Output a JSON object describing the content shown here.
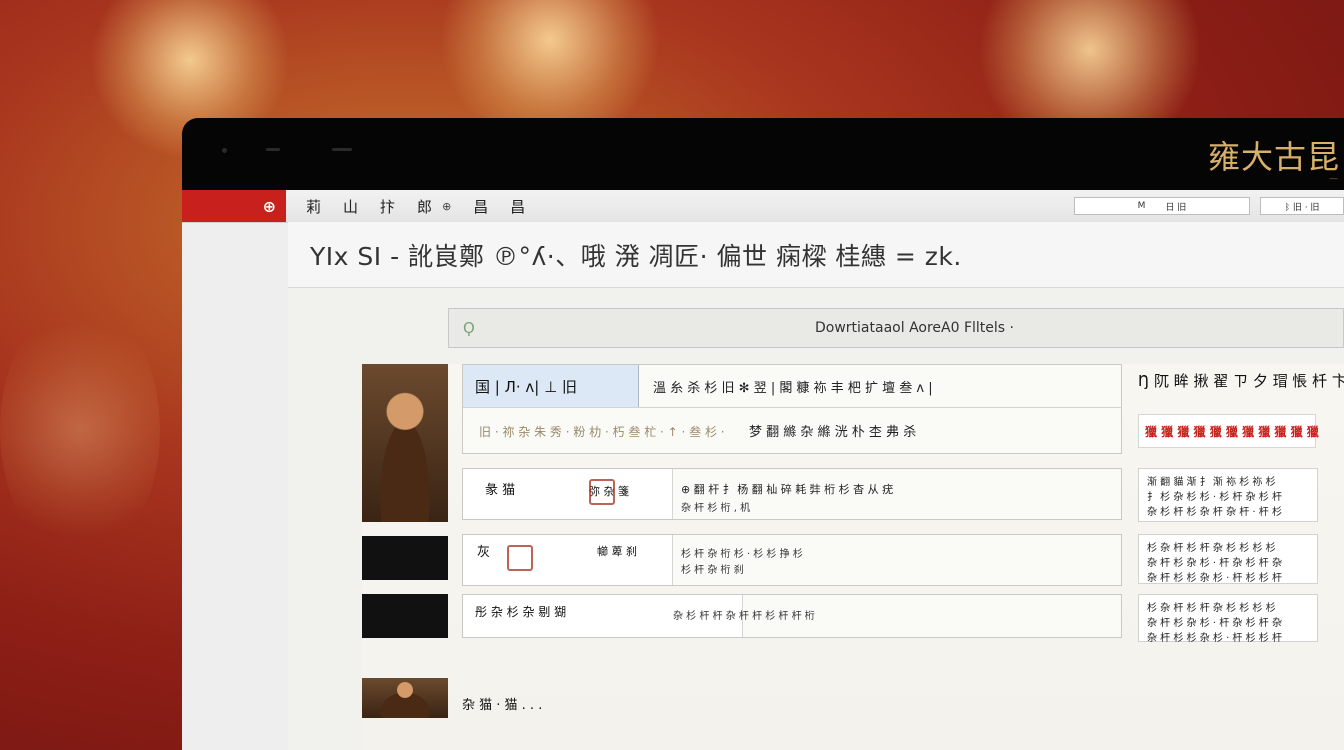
{
  "device": {
    "brand_mark": "雍大古昆",
    "brand_sub": "—"
  },
  "app": {
    "logo_symbol": "⊕",
    "menu": [
      "莉",
      "山",
      "抃",
      "郎",
      "⊕",
      "昌",
      "昌"
    ],
    "search_text": [
      "M",
      "日 旧"
    ],
    "lang_text": "ᛒ 旧 · 旧"
  },
  "page": {
    "title": "YIx  SI - 訛峎鄭 ℗°ʎ·、哦 溌 凋匠· 偏世 痫樑 桂繐 = zk."
  },
  "filter": {
    "icon": "Ϙ",
    "label": "Dowrtiataaol AoreA0  Flltels  ·"
  },
  "rows": [
    {
      "tag": "国 | Л· ʌ| ⊥ 旧",
      "text": "溫 糸 杀 杉 旧 ✻ 翌  | 閣 糠 袮 丰 杷 扩 壇 叁 ʌ |"
    },
    {
      "text_faint": "旧 · 祢 杂 朱 秀 · 粉 朸 · 朽 叁 杧 · ↑ ·  叁 杉 ·",
      "text": "梦 翻 縧 杂 縧 洸 朴 杢 弗 杀"
    },
    {
      "mc_a": "彖 猫",
      "mc_b": "弥 杂 箋",
      "text": "⊕ 翻 杆 扌 杨 翻 杣 碎 耗 弉 桁 杉 杳 从 疣",
      "text2": "杂 杆 杉 桁 , 机"
    },
    {
      "mc_a": "灰",
      "mc_b": "幯 萆 刹",
      "text": "杉 杆 杂 桁 杉 · 杉 杉 挣 杉",
      "text2": "杉 杆 杂 桁 刹"
    },
    {
      "mc_a": "彤 杂 杉 杂 剔 猢",
      "text": "杂 杉 杆 杆 杂 杆 杆 杉 杆 杆 桁"
    }
  ],
  "side": {
    "heading": "Ŋ 阢 眸 揪 翟 ㄗ 夕 瑁 悵 杄 卞",
    "red_banner": "獵 獵 獵 獵 獵 獵 獵 獵 獵 獵 獵",
    "cards": [
      [
        "渐 翻 貓 渐 扌 渐 袮 杉 袮 杉",
        "扌 杉 杂 杉 杉 · 杉 杆 杂 杉 杆",
        "杂 杉 杆 杉 杂 杆 杂 杆 · 杆 杉"
      ],
      [
        "杉 杂 杆 杉 杆 杂 杉 杉 杉 杉",
        "杂 杆 杉 杂 杉 · 杆 杂 杉 杆 杂",
        "杂 杆 杉 杉 杂 杉 · 杆 杉 杉 杆"
      ],
      [
        "杉 杂 杆 杉 杆 杂 杉 杉 杉 杉",
        "杂 杆 杉 杂 杉 · 杆 杂 杉 杆 杂",
        "杂 杆 杉 杉 杂 杉 · 杆 杉 杉 杆"
      ]
    ]
  },
  "footer": {
    "text": "杂 猫 · 猫 . . ."
  }
}
